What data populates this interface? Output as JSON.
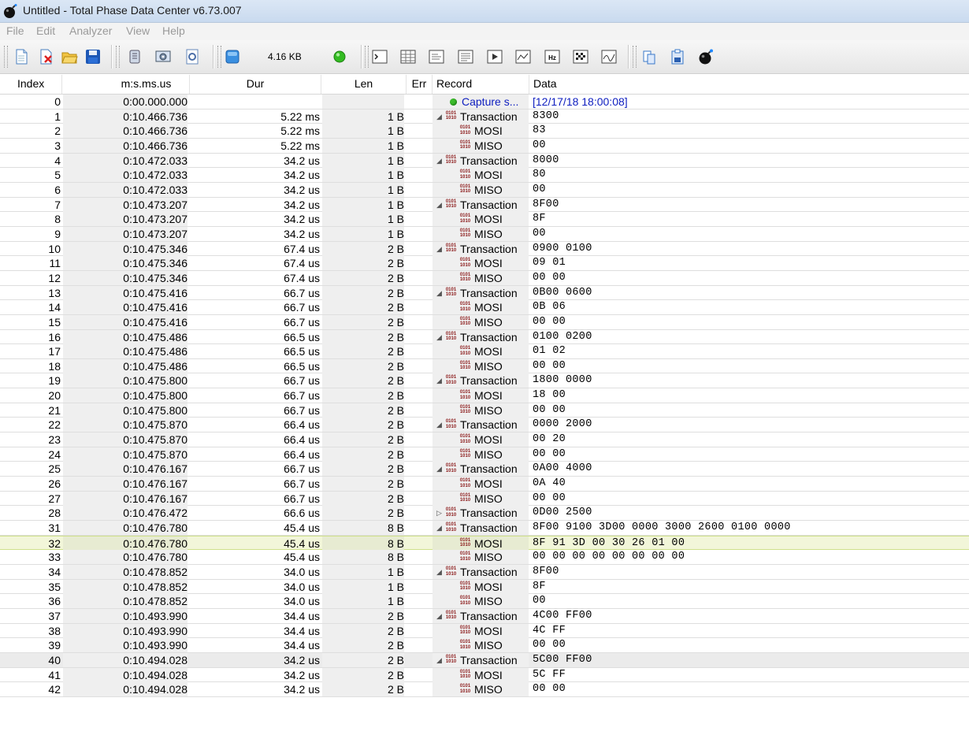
{
  "window": {
    "title": "Untitled - Total Phase Data Center v6.73.007"
  },
  "menu": [
    "File",
    "Edit",
    "Analyzer",
    "View",
    "Help"
  ],
  "toolbar": {
    "capture_size": "4.16 KB",
    "status_color": "#33bb22",
    "buttons": [
      "new-file-icon",
      "close-file-icon",
      "open-folder-icon",
      "save-icon",
      "adapter-icon",
      "device-settings-icon",
      "config-icon",
      "capture-stop-icon",
      "terminal-icon",
      "table-view-icon",
      "info-pane-icon",
      "data-pane-icon",
      "playback-icon",
      "packet-view-icon",
      "frequency-icon",
      "pattern-icon",
      "graph-icon",
      "copy-icon",
      "clipboard-icon",
      "bomb-icon"
    ]
  },
  "columns": {
    "index": "Index",
    "time": "m:s.ms.us",
    "dur": "Dur",
    "len": "Len",
    "err": "Err",
    "record": "Record",
    "data": "Data"
  },
  "rows": [
    {
      "index": "0",
      "time": "0:00.000.000",
      "dur": "",
      "len": "",
      "record": "Capture s...",
      "data": "[12/17/18 18:00:08]",
      "type": "capture"
    },
    {
      "index": "1",
      "time": "0:10.466.736",
      "dur": "5.22 ms",
      "len": "1 B",
      "record": "Transaction",
      "data": "8300",
      "type": "txn",
      "exp": "open"
    },
    {
      "index": "2",
      "time": "0:10.466.736",
      "dur": "5.22 ms",
      "len": "1 B",
      "record": "MOSI",
      "data": "83",
      "type": "sub"
    },
    {
      "index": "3",
      "time": "0:10.466.736",
      "dur": "5.22 ms",
      "len": "1 B",
      "record": "MISO",
      "data": "00",
      "type": "sub"
    },
    {
      "index": "4",
      "time": "0:10.472.033",
      "dur": "34.2 us",
      "len": "1 B",
      "record": "Transaction",
      "data": "8000",
      "type": "txn",
      "exp": "open"
    },
    {
      "index": "5",
      "time": "0:10.472.033",
      "dur": "34.2 us",
      "len": "1 B",
      "record": "MOSI",
      "data": "80",
      "type": "sub"
    },
    {
      "index": "6",
      "time": "0:10.472.033",
      "dur": "34.2 us",
      "len": "1 B",
      "record": "MISO",
      "data": "00",
      "type": "sub"
    },
    {
      "index": "7",
      "time": "0:10.473.207",
      "dur": "34.2 us",
      "len": "1 B",
      "record": "Transaction",
      "data": "8F00",
      "type": "txn",
      "exp": "open"
    },
    {
      "index": "8",
      "time": "0:10.473.207",
      "dur": "34.2 us",
      "len": "1 B",
      "record": "MOSI",
      "data": "8F",
      "type": "sub"
    },
    {
      "index": "9",
      "time": "0:10.473.207",
      "dur": "34.2 us",
      "len": "1 B",
      "record": "MISO",
      "data": "00",
      "type": "sub"
    },
    {
      "index": "10",
      "time": "0:10.475.346",
      "dur": "67.4 us",
      "len": "2 B",
      "record": "Transaction",
      "data": "0900 0100",
      "type": "txn",
      "exp": "open"
    },
    {
      "index": "11",
      "time": "0:10.475.346",
      "dur": "67.4 us",
      "len": "2 B",
      "record": "MOSI",
      "data": "09 01",
      "type": "sub"
    },
    {
      "index": "12",
      "time": "0:10.475.346",
      "dur": "67.4 us",
      "len": "2 B",
      "record": "MISO",
      "data": "00 00",
      "type": "sub"
    },
    {
      "index": "13",
      "time": "0:10.475.416",
      "dur": "66.7 us",
      "len": "2 B",
      "record": "Transaction",
      "data": "0B00 0600",
      "type": "txn",
      "exp": "open"
    },
    {
      "index": "14",
      "time": "0:10.475.416",
      "dur": "66.7 us",
      "len": "2 B",
      "record": "MOSI",
      "data": "0B 06",
      "type": "sub"
    },
    {
      "index": "15",
      "time": "0:10.475.416",
      "dur": "66.7 us",
      "len": "2 B",
      "record": "MISO",
      "data": "00 00",
      "type": "sub"
    },
    {
      "index": "16",
      "time": "0:10.475.486",
      "dur": "66.5 us",
      "len": "2 B",
      "record": "Transaction",
      "data": "0100 0200",
      "type": "txn",
      "exp": "open"
    },
    {
      "index": "17",
      "time": "0:10.475.486",
      "dur": "66.5 us",
      "len": "2 B",
      "record": "MOSI",
      "data": "01 02",
      "type": "sub"
    },
    {
      "index": "18",
      "time": "0:10.475.486",
      "dur": "66.5 us",
      "len": "2 B",
      "record": "MISO",
      "data": "00 00",
      "type": "sub"
    },
    {
      "index": "19",
      "time": "0:10.475.800",
      "dur": "66.7 us",
      "len": "2 B",
      "record": "Transaction",
      "data": "1800 0000",
      "type": "txn",
      "exp": "open"
    },
    {
      "index": "20",
      "time": "0:10.475.800",
      "dur": "66.7 us",
      "len": "2 B",
      "record": "MOSI",
      "data": "18 00",
      "type": "sub"
    },
    {
      "index": "21",
      "time": "0:10.475.800",
      "dur": "66.7 us",
      "len": "2 B",
      "record": "MISO",
      "data": "00 00",
      "type": "sub"
    },
    {
      "index": "22",
      "time": "0:10.475.870",
      "dur": "66.4 us",
      "len": "2 B",
      "record": "Transaction",
      "data": "0000 2000",
      "type": "txn",
      "exp": "open"
    },
    {
      "index": "23",
      "time": "0:10.475.870",
      "dur": "66.4 us",
      "len": "2 B",
      "record": "MOSI",
      "data": "00 20",
      "type": "sub"
    },
    {
      "index": "24",
      "time": "0:10.475.870",
      "dur": "66.4 us",
      "len": "2 B",
      "record": "MISO",
      "data": "00 00",
      "type": "sub"
    },
    {
      "index": "25",
      "time": "0:10.476.167",
      "dur": "66.7 us",
      "len": "2 B",
      "record": "Transaction",
      "data": "0A00 4000",
      "type": "txn",
      "exp": "open"
    },
    {
      "index": "26",
      "time": "0:10.476.167",
      "dur": "66.7 us",
      "len": "2 B",
      "record": "MOSI",
      "data": "0A 40",
      "type": "sub"
    },
    {
      "index": "27",
      "time": "0:10.476.167",
      "dur": "66.7 us",
      "len": "2 B",
      "record": "MISO",
      "data": "00 00",
      "type": "sub"
    },
    {
      "index": "28",
      "time": "0:10.476.472",
      "dur": "66.6 us",
      "len": "2 B",
      "record": "Transaction",
      "data": "0D00 2500",
      "type": "txn",
      "exp": "closed"
    },
    {
      "index": "31",
      "time": "0:10.476.780",
      "dur": "45.4 us",
      "len": "8 B",
      "record": "Transaction",
      "data": "8F00 9100 3D00 0000 3000 2600 0100 0000",
      "type": "txn",
      "exp": "open"
    },
    {
      "index": "32",
      "time": "0:10.476.780",
      "dur": "45.4 us",
      "len": "8 B",
      "record": "MOSI",
      "data": "8F 91 3D 00 30 26 01 00",
      "type": "sub",
      "selected": true
    },
    {
      "index": "33",
      "time": "0:10.476.780",
      "dur": "45.4 us",
      "len": "8 B",
      "record": "MISO",
      "data": "00 00 00 00 00 00 00 00",
      "type": "sub"
    },
    {
      "index": "34",
      "time": "0:10.478.852",
      "dur": "34.0 us",
      "len": "1 B",
      "record": "Transaction",
      "data": "8F00",
      "type": "txn",
      "exp": "open"
    },
    {
      "index": "35",
      "time": "0:10.478.852",
      "dur": "34.0 us",
      "len": "1 B",
      "record": "MOSI",
      "data": "8F",
      "type": "sub"
    },
    {
      "index": "36",
      "time": "0:10.478.852",
      "dur": "34.0 us",
      "len": "1 B",
      "record": "MISO",
      "data": "00",
      "type": "sub"
    },
    {
      "index": "37",
      "time": "0:10.493.990",
      "dur": "34.4 us",
      "len": "2 B",
      "record": "Transaction",
      "data": "4C00 FF00",
      "type": "txn",
      "exp": "open"
    },
    {
      "index": "38",
      "time": "0:10.493.990",
      "dur": "34.4 us",
      "len": "2 B",
      "record": "MOSI",
      "data": "4C FF",
      "type": "sub"
    },
    {
      "index": "39",
      "time": "0:10.493.990",
      "dur": "34.4 us",
      "len": "2 B",
      "record": "MISO",
      "data": "00 00",
      "type": "sub"
    },
    {
      "index": "40",
      "time": "0:10.494.028",
      "dur": "34.2 us",
      "len": "2 B",
      "record": "Transaction",
      "data": "5C00 FF00",
      "type": "txn",
      "exp": "open",
      "alt": true
    },
    {
      "index": "41",
      "time": "0:10.494.028",
      "dur": "34.2 us",
      "len": "2 B",
      "record": "MOSI",
      "data": "5C FF",
      "type": "sub"
    },
    {
      "index": "42",
      "time": "0:10.494.028",
      "dur": "34.2 us",
      "len": "2 B",
      "record": "MISO",
      "data": "00 00",
      "type": "sub"
    }
  ]
}
